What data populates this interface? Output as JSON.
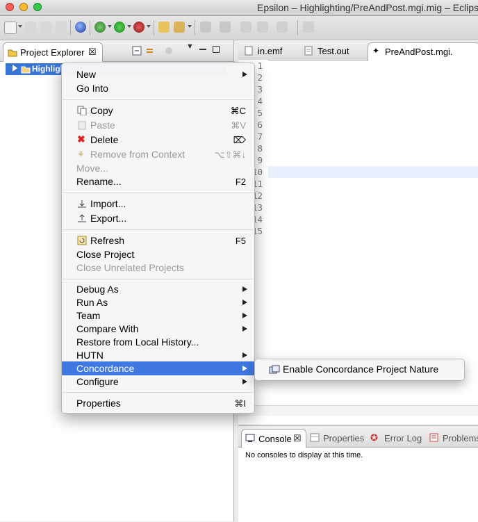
{
  "window": {
    "title": "Epsilon – Highlighting/PreAndPost.mgi.mig – Eclips"
  },
  "explorer": {
    "tab_label": "Project Explorer",
    "tree_item": "Highligh"
  },
  "editor": {
    "tabs": [
      "in.emf",
      "Test.out",
      "PreAndPost.mgi."
    ],
    "line_numbers": [
      "1",
      "2",
      "3",
      "4",
      "5",
      "6",
      "7",
      "8",
      "9",
      "10",
      "11",
      "12",
      "13",
      "14",
      "15"
    ],
    "current_line": 10
  },
  "console": {
    "tabs": [
      "Console",
      "Properties",
      "Error Log",
      "Problems"
    ],
    "message": "No consoles to display at this time."
  },
  "context_menu": {
    "new": "New",
    "go_into": "Go Into",
    "copy": "Copy",
    "copy_sc": "⌘C",
    "paste": "Paste",
    "paste_sc": "⌘V",
    "delete": "Delete",
    "delete_sc": "⌦",
    "remove_ctx": "Remove from Context",
    "remove_ctx_sc": "⌥⇧⌘↓",
    "move": "Move...",
    "rename": "Rename...",
    "rename_sc": "F2",
    "import": "Import...",
    "export": "Export...",
    "refresh": "Refresh",
    "refresh_sc": "F5",
    "close_project": "Close Project",
    "close_unrelated": "Close Unrelated Projects",
    "debug_as": "Debug As",
    "run_as": "Run As",
    "team": "Team",
    "compare_with": "Compare With",
    "restore_history": "Restore from Local History...",
    "hutn": "HUTN",
    "concordance": "Concordance",
    "configure": "Configure",
    "properties": "Properties",
    "properties_sc": "⌘I"
  },
  "submenu": {
    "enable_concordance": "Enable Concordance Project Nature"
  },
  "colors": {
    "keyword": "#7f0055",
    "selection": "#3f78e0",
    "current_line": "#e8f2fe"
  }
}
